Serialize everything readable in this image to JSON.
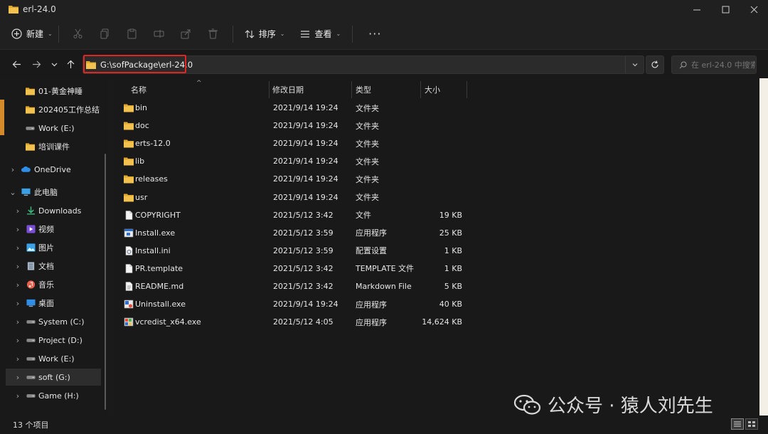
{
  "window": {
    "title": "erl-24.0"
  },
  "toolbar": {
    "new_label": "新建",
    "sort_label": "排序",
    "view_label": "查看",
    "more_label": "···"
  },
  "address": {
    "path": "G:\\sofPackage\\erl-24.0"
  },
  "search": {
    "placeholder": "在 erl-24.0 中搜索"
  },
  "sidebar": {
    "items": [
      {
        "label": "01-黄金神睡",
        "icon": "folder-icon"
      },
      {
        "label": "202405工作总结",
        "icon": "folder-icon"
      },
      {
        "label": "Work (E:)",
        "icon": "drive-icon"
      },
      {
        "label": "培训课件",
        "icon": "folder-icon"
      },
      {
        "label": "OneDrive",
        "icon": "cloud-icon"
      },
      {
        "label": "此电脑",
        "icon": "computer-icon"
      },
      {
        "label": "Downloads",
        "icon": "download-icon"
      },
      {
        "label": "视频",
        "icon": "video-icon"
      },
      {
        "label": "图片",
        "icon": "picture-icon"
      },
      {
        "label": "文档",
        "icon": "document-icon"
      },
      {
        "label": "音乐",
        "icon": "music-icon"
      },
      {
        "label": "桌面",
        "icon": "desktop-icon"
      },
      {
        "label": "System (C:)",
        "icon": "drive-icon"
      },
      {
        "label": "Project (D:)",
        "icon": "drive-icon"
      },
      {
        "label": "Work (E:)",
        "icon": "drive-icon"
      },
      {
        "label": "soft (G:)",
        "icon": "drive-icon"
      },
      {
        "label": "Game (H:)",
        "icon": "drive-icon"
      }
    ]
  },
  "columns": {
    "name": "名称",
    "date": "修改日期",
    "type": "类型",
    "size": "大小"
  },
  "files": [
    {
      "name": "bin",
      "date": "2021/9/14 19:24",
      "type": "文件夹",
      "size": "",
      "icon": "folder-icon"
    },
    {
      "name": "doc",
      "date": "2021/9/14 19:24",
      "type": "文件夹",
      "size": "",
      "icon": "folder-icon"
    },
    {
      "name": "erts-12.0",
      "date": "2021/9/14 19:24",
      "type": "文件夹",
      "size": "",
      "icon": "folder-icon"
    },
    {
      "name": "lib",
      "date": "2021/9/14 19:24",
      "type": "文件夹",
      "size": "",
      "icon": "folder-icon"
    },
    {
      "name": "releases",
      "date": "2021/9/14 19:24",
      "type": "文件夹",
      "size": "",
      "icon": "folder-icon"
    },
    {
      "name": "usr",
      "date": "2021/9/14 19:24",
      "type": "文件夹",
      "size": "",
      "icon": "folder-icon"
    },
    {
      "name": "COPYRIGHT",
      "date": "2021/5/12 3:42",
      "type": "文件",
      "size": "19 KB",
      "icon": "file-icon"
    },
    {
      "name": "Install.exe",
      "date": "2021/5/12 3:59",
      "type": "应用程序",
      "size": "25 KB",
      "icon": "exe-icon"
    },
    {
      "name": "Install.ini",
      "date": "2021/5/12 3:59",
      "type": "配置设置",
      "size": "1 KB",
      "icon": "settings-file-icon"
    },
    {
      "name": "PR.template",
      "date": "2021/5/12 3:42",
      "type": "TEMPLATE 文件",
      "size": "1 KB",
      "icon": "file-icon"
    },
    {
      "name": "README.md",
      "date": "2021/5/12 3:42",
      "type": "Markdown File",
      "size": "5 KB",
      "icon": "markdown-file-icon"
    },
    {
      "name": "Uninstall.exe",
      "date": "2021/9/14 19:24",
      "type": "应用程序",
      "size": "40 KB",
      "icon": "uninstall-exe-icon"
    },
    {
      "name": "vcredist_x64.exe",
      "date": "2021/5/12 4:05",
      "type": "应用程序",
      "size": "14,624 KB",
      "icon": "installer-exe-icon"
    }
  ],
  "status": {
    "count": "13 个项目"
  },
  "watermark": {
    "text": "公众号 · 猿人刘先生"
  },
  "colors": {
    "folder": "#f2c14e",
    "highlight": "#e02525",
    "background": "#191919"
  }
}
